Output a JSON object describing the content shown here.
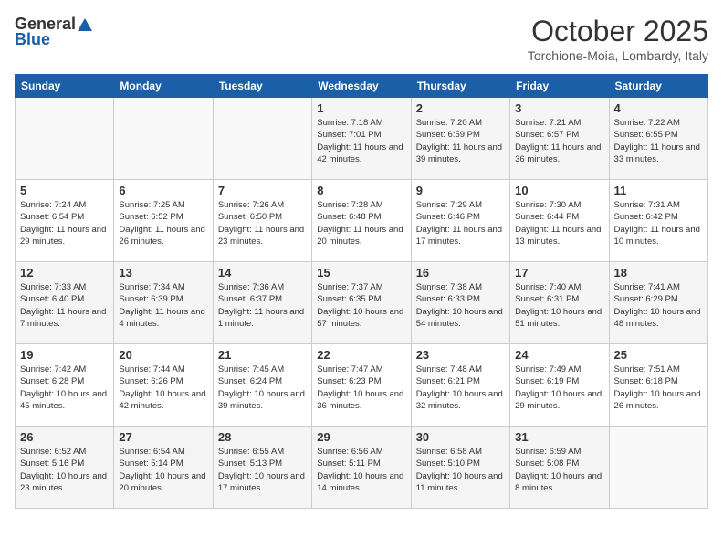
{
  "header": {
    "logo_general": "General",
    "logo_blue": "Blue",
    "month_title": "October 2025",
    "location": "Torchione-Moia, Lombardy, Italy"
  },
  "weekdays": [
    "Sunday",
    "Monday",
    "Tuesday",
    "Wednesday",
    "Thursday",
    "Friday",
    "Saturday"
  ],
  "weeks": [
    [
      {
        "day": "",
        "sunrise": "",
        "sunset": "",
        "daylight": ""
      },
      {
        "day": "",
        "sunrise": "",
        "sunset": "",
        "daylight": ""
      },
      {
        "day": "",
        "sunrise": "",
        "sunset": "",
        "daylight": ""
      },
      {
        "day": "1",
        "sunrise": "Sunrise: 7:18 AM",
        "sunset": "Sunset: 7:01 PM",
        "daylight": "Daylight: 11 hours and 42 minutes."
      },
      {
        "day": "2",
        "sunrise": "Sunrise: 7:20 AM",
        "sunset": "Sunset: 6:59 PM",
        "daylight": "Daylight: 11 hours and 39 minutes."
      },
      {
        "day": "3",
        "sunrise": "Sunrise: 7:21 AM",
        "sunset": "Sunset: 6:57 PM",
        "daylight": "Daylight: 11 hours and 36 minutes."
      },
      {
        "day": "4",
        "sunrise": "Sunrise: 7:22 AM",
        "sunset": "Sunset: 6:55 PM",
        "daylight": "Daylight: 11 hours and 33 minutes."
      }
    ],
    [
      {
        "day": "5",
        "sunrise": "Sunrise: 7:24 AM",
        "sunset": "Sunset: 6:54 PM",
        "daylight": "Daylight: 11 hours and 29 minutes."
      },
      {
        "day": "6",
        "sunrise": "Sunrise: 7:25 AM",
        "sunset": "Sunset: 6:52 PM",
        "daylight": "Daylight: 11 hours and 26 minutes."
      },
      {
        "day": "7",
        "sunrise": "Sunrise: 7:26 AM",
        "sunset": "Sunset: 6:50 PM",
        "daylight": "Daylight: 11 hours and 23 minutes."
      },
      {
        "day": "8",
        "sunrise": "Sunrise: 7:28 AM",
        "sunset": "Sunset: 6:48 PM",
        "daylight": "Daylight: 11 hours and 20 minutes."
      },
      {
        "day": "9",
        "sunrise": "Sunrise: 7:29 AM",
        "sunset": "Sunset: 6:46 PM",
        "daylight": "Daylight: 11 hours and 17 minutes."
      },
      {
        "day": "10",
        "sunrise": "Sunrise: 7:30 AM",
        "sunset": "Sunset: 6:44 PM",
        "daylight": "Daylight: 11 hours and 13 minutes."
      },
      {
        "day": "11",
        "sunrise": "Sunrise: 7:31 AM",
        "sunset": "Sunset: 6:42 PM",
        "daylight": "Daylight: 11 hours and 10 minutes."
      }
    ],
    [
      {
        "day": "12",
        "sunrise": "Sunrise: 7:33 AM",
        "sunset": "Sunset: 6:40 PM",
        "daylight": "Daylight: 11 hours and 7 minutes."
      },
      {
        "day": "13",
        "sunrise": "Sunrise: 7:34 AM",
        "sunset": "Sunset: 6:39 PM",
        "daylight": "Daylight: 11 hours and 4 minutes."
      },
      {
        "day": "14",
        "sunrise": "Sunrise: 7:36 AM",
        "sunset": "Sunset: 6:37 PM",
        "daylight": "Daylight: 11 hours and 1 minute."
      },
      {
        "day": "15",
        "sunrise": "Sunrise: 7:37 AM",
        "sunset": "Sunset: 6:35 PM",
        "daylight": "Daylight: 10 hours and 57 minutes."
      },
      {
        "day": "16",
        "sunrise": "Sunrise: 7:38 AM",
        "sunset": "Sunset: 6:33 PM",
        "daylight": "Daylight: 10 hours and 54 minutes."
      },
      {
        "day": "17",
        "sunrise": "Sunrise: 7:40 AM",
        "sunset": "Sunset: 6:31 PM",
        "daylight": "Daylight: 10 hours and 51 minutes."
      },
      {
        "day": "18",
        "sunrise": "Sunrise: 7:41 AM",
        "sunset": "Sunset: 6:29 PM",
        "daylight": "Daylight: 10 hours and 48 minutes."
      }
    ],
    [
      {
        "day": "19",
        "sunrise": "Sunrise: 7:42 AM",
        "sunset": "Sunset: 6:28 PM",
        "daylight": "Daylight: 10 hours and 45 minutes."
      },
      {
        "day": "20",
        "sunrise": "Sunrise: 7:44 AM",
        "sunset": "Sunset: 6:26 PM",
        "daylight": "Daylight: 10 hours and 42 minutes."
      },
      {
        "day": "21",
        "sunrise": "Sunrise: 7:45 AM",
        "sunset": "Sunset: 6:24 PM",
        "daylight": "Daylight: 10 hours and 39 minutes."
      },
      {
        "day": "22",
        "sunrise": "Sunrise: 7:47 AM",
        "sunset": "Sunset: 6:23 PM",
        "daylight": "Daylight: 10 hours and 36 minutes."
      },
      {
        "day": "23",
        "sunrise": "Sunrise: 7:48 AM",
        "sunset": "Sunset: 6:21 PM",
        "daylight": "Daylight: 10 hours and 32 minutes."
      },
      {
        "day": "24",
        "sunrise": "Sunrise: 7:49 AM",
        "sunset": "Sunset: 6:19 PM",
        "daylight": "Daylight: 10 hours and 29 minutes."
      },
      {
        "day": "25",
        "sunrise": "Sunrise: 7:51 AM",
        "sunset": "Sunset: 6:18 PM",
        "daylight": "Daylight: 10 hours and 26 minutes."
      }
    ],
    [
      {
        "day": "26",
        "sunrise": "Sunrise: 6:52 AM",
        "sunset": "Sunset: 5:16 PM",
        "daylight": "Daylight: 10 hours and 23 minutes."
      },
      {
        "day": "27",
        "sunrise": "Sunrise: 6:54 AM",
        "sunset": "Sunset: 5:14 PM",
        "daylight": "Daylight: 10 hours and 20 minutes."
      },
      {
        "day": "28",
        "sunrise": "Sunrise: 6:55 AM",
        "sunset": "Sunset: 5:13 PM",
        "daylight": "Daylight: 10 hours and 17 minutes."
      },
      {
        "day": "29",
        "sunrise": "Sunrise: 6:56 AM",
        "sunset": "Sunset: 5:11 PM",
        "daylight": "Daylight: 10 hours and 14 minutes."
      },
      {
        "day": "30",
        "sunrise": "Sunrise: 6:58 AM",
        "sunset": "Sunset: 5:10 PM",
        "daylight": "Daylight: 10 hours and 11 minutes."
      },
      {
        "day": "31",
        "sunrise": "Sunrise: 6:59 AM",
        "sunset": "Sunset: 5:08 PM",
        "daylight": "Daylight: 10 hours and 8 minutes."
      },
      {
        "day": "",
        "sunrise": "",
        "sunset": "",
        "daylight": ""
      }
    ]
  ]
}
